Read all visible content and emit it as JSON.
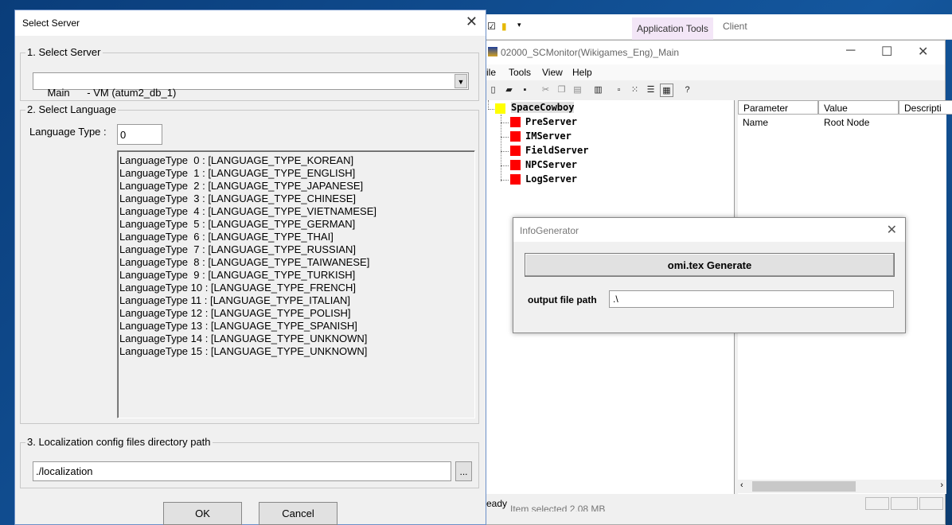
{
  "explorer": {
    "tab_app_tools": "Application Tools",
    "tab_client": "Client"
  },
  "main_window": {
    "title": "02000_SCMonitor(Wikigames_Eng)_Main",
    "menu": [
      "ile",
      "Tools",
      "View",
      "Help"
    ],
    "tree": {
      "root": "SpaceCowboy",
      "children": [
        "PreServer",
        "IMServer",
        "FieldServer",
        "NPCServer",
        "LogServer"
      ]
    },
    "properties": {
      "headers": [
        "Parameter",
        "Value",
        "Descripti"
      ],
      "rows": [
        [
          "Name",
          "Root Node"
        ]
      ]
    },
    "status_text": "eady",
    "status_secondary": "Item selected 2,08 MB",
    "colors": {
      "root_box": "#ffff00",
      "server_box": "#ff0000"
    }
  },
  "info_dialog": {
    "title": "InfoGenerator",
    "generate_button": "omi.tex Generate",
    "output_label": "output file path",
    "output_value": ".\\"
  },
  "select_dialog": {
    "title": "Select Server",
    "group1_legend": "1. Select Server",
    "server_selected": "Main      - VM (atum2_db_1)",
    "group2_legend": "2. Select Language",
    "language_type_label": "Language Type :",
    "language_type_value": "0",
    "language_list": [
      "LanguageType  0 : [LANGUAGE_TYPE_KOREAN]",
      "LanguageType  1 : [LANGUAGE_TYPE_ENGLISH]",
      "LanguageType  2 : [LANGUAGE_TYPE_JAPANESE]",
      "LanguageType  3 : [LANGUAGE_TYPE_CHINESE]",
      "LanguageType  4 : [LANGUAGE_TYPE_VIETNAMESE]",
      "LanguageType  5 : [LANGUAGE_TYPE_GERMAN]",
      "LanguageType  6 : [LANGUAGE_TYPE_THAI]",
      "LanguageType  7 : [LANGUAGE_TYPE_RUSSIAN]",
      "LanguageType  8 : [LANGUAGE_TYPE_TAIWANESE]",
      "LanguageType  9 : [LANGUAGE_TYPE_TURKISH]",
      "LanguageType 10 : [LANGUAGE_TYPE_FRENCH]",
      "LanguageType 11 : [LANGUAGE_TYPE_ITALIAN]",
      "LanguageType 12 : [LANGUAGE_TYPE_POLISH]",
      "LanguageType 13 : [LANGUAGE_TYPE_SPANISH]",
      "LanguageType 14 : [LANGUAGE_TYPE_UNKNOWN]",
      "LanguageType 15 : [LANGUAGE_TYPE_UNKNOWN]"
    ],
    "group3_legend": "3. Localization config files directory path",
    "path_value": "./localization",
    "browse_label": "...",
    "ok_label": "OK",
    "cancel_label": "Cancel"
  }
}
